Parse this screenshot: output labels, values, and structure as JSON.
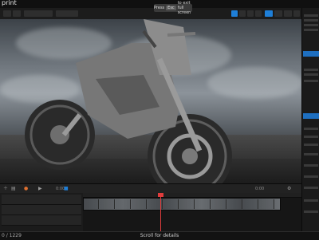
{
  "app": {
    "title": "print"
  },
  "overlay": {
    "press_label": "Press",
    "key": "Esc",
    "to_exit": "to exit full screen"
  },
  "sequencer": {
    "current_time": "0:00",
    "end_time": "0:00"
  },
  "bottom": {
    "frame_count": "0 / 1229",
    "scroll_hint": "Scroll for details"
  },
  "colors": {
    "accent": "#1e7fd8",
    "playhead": "#e03c3c"
  }
}
